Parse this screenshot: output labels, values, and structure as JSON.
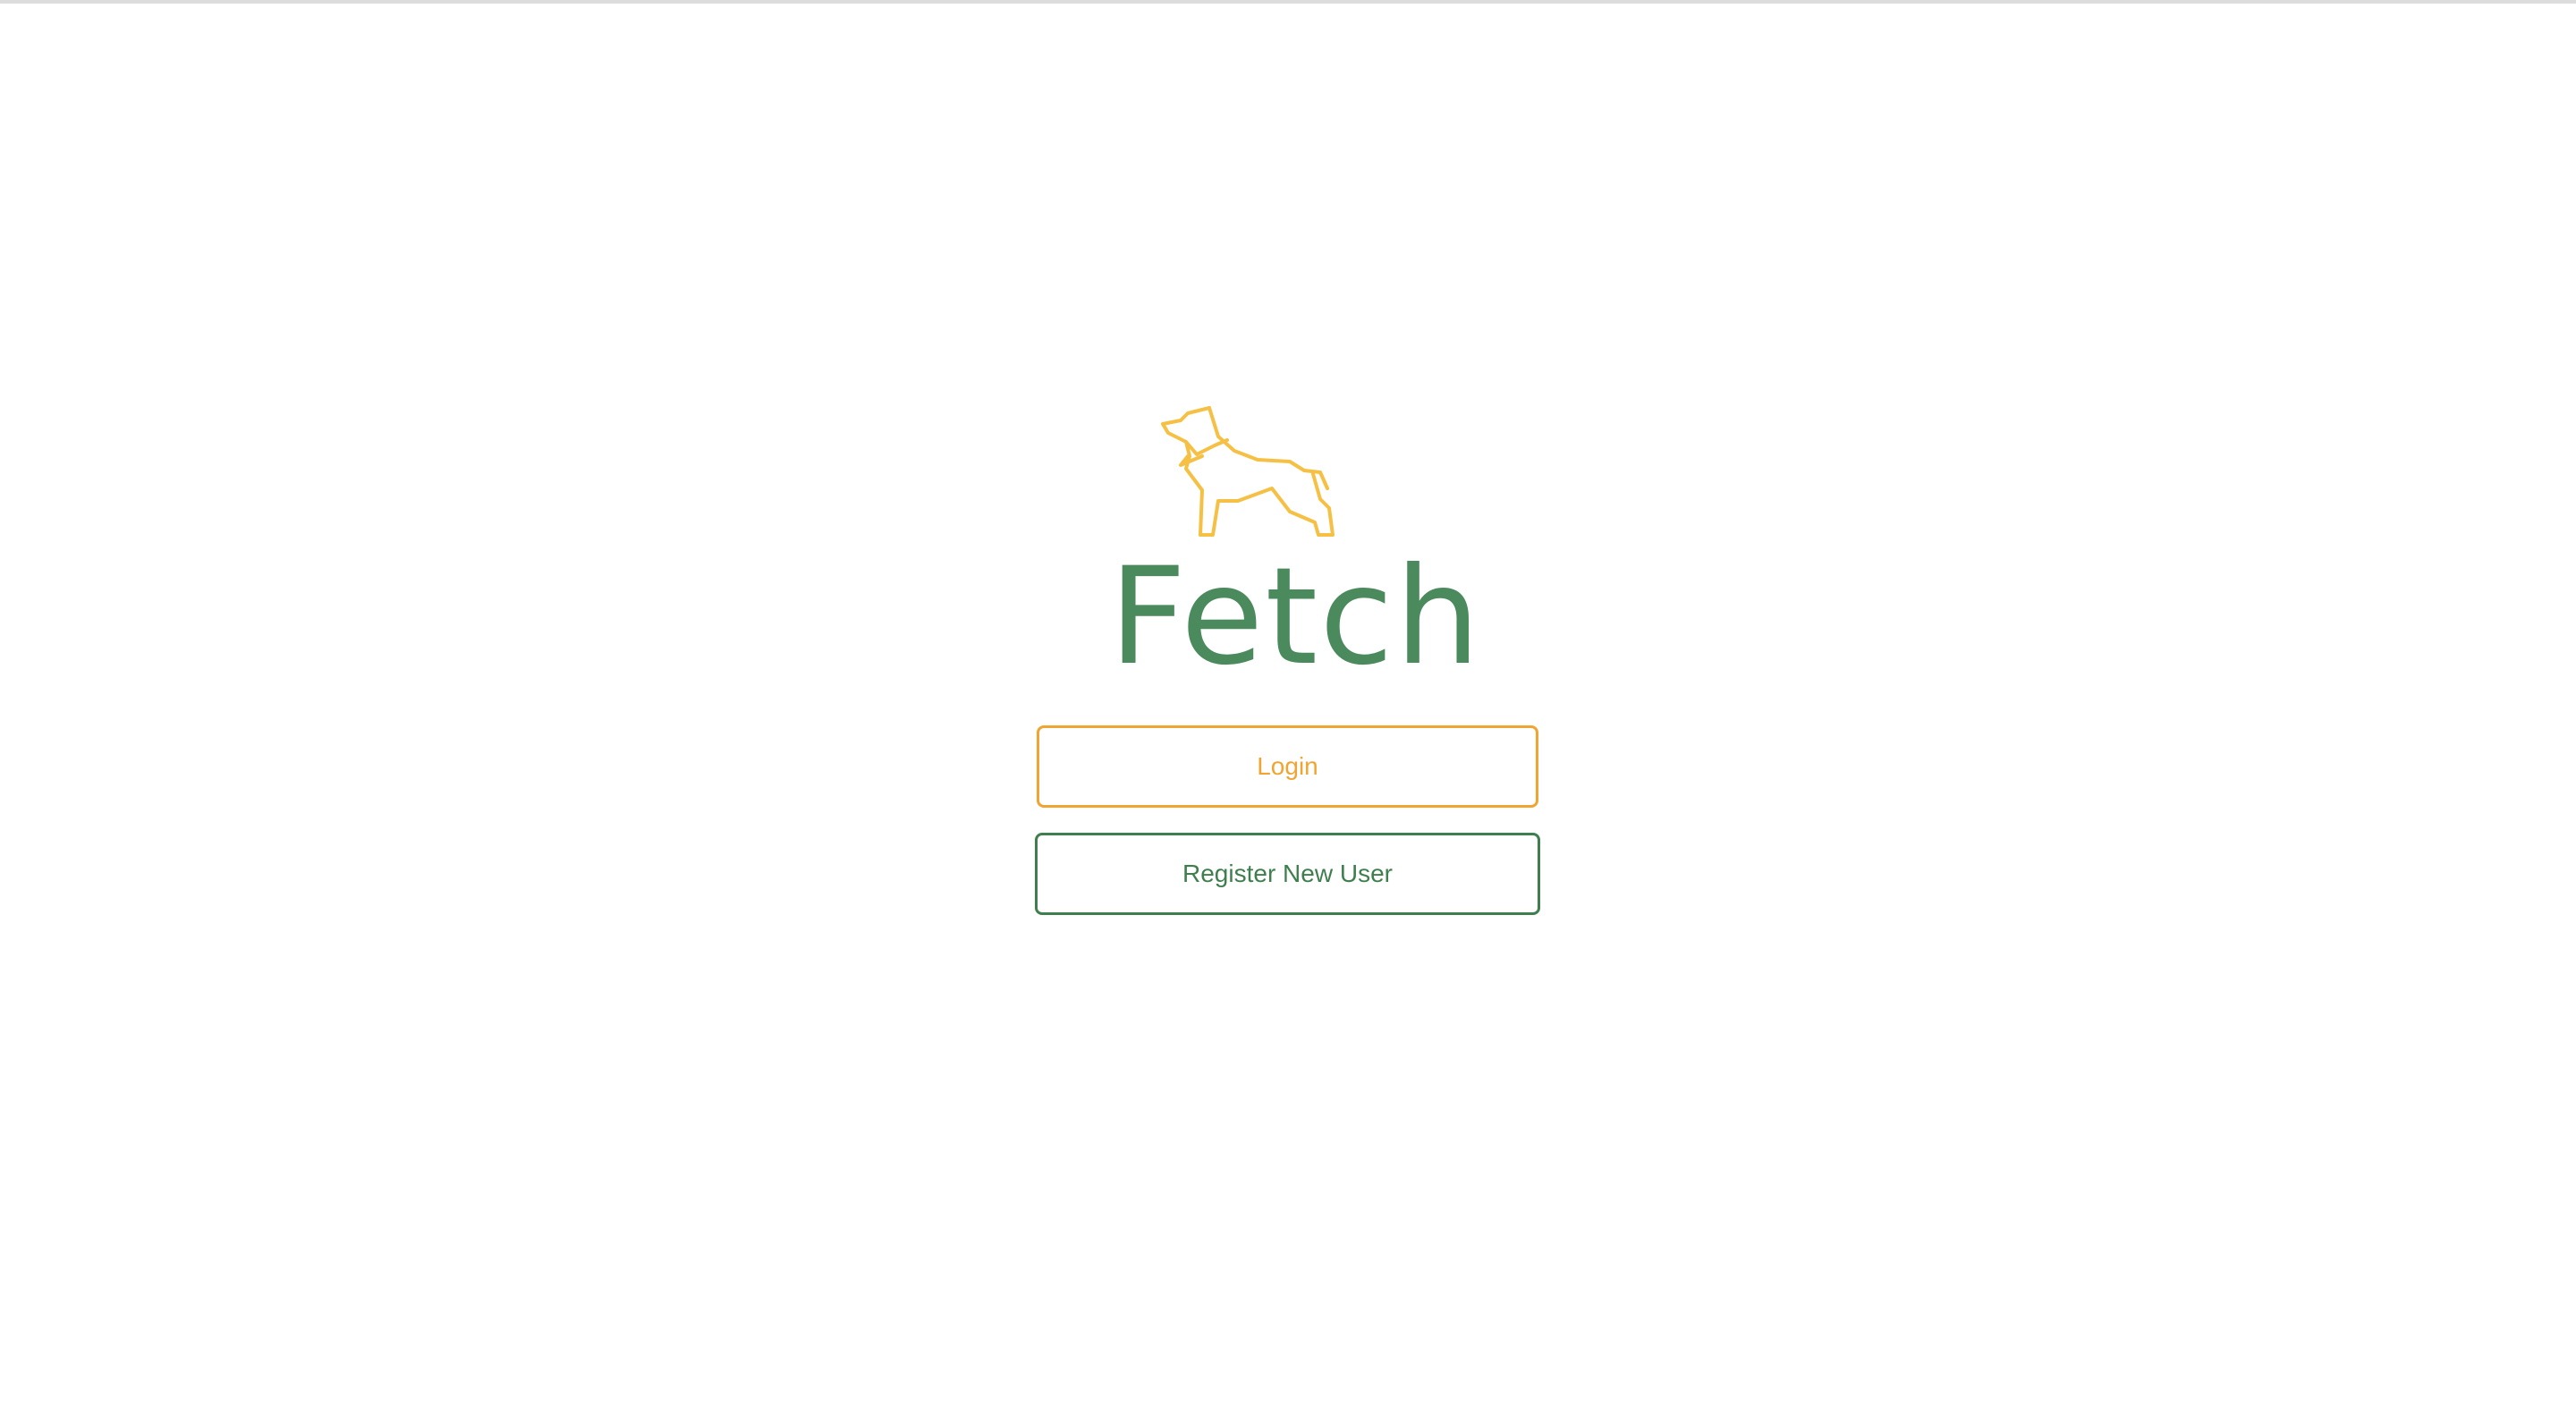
{
  "brand": {
    "name": "Fetch",
    "logo_icon": "dog-outline-icon",
    "logo_color": "#f5c043",
    "title_color": "#4a8a5c"
  },
  "actions": {
    "login_label": "Login",
    "register_label": "Register New User",
    "login_color": "#f0a532",
    "register_color": "#3f7f4e"
  }
}
